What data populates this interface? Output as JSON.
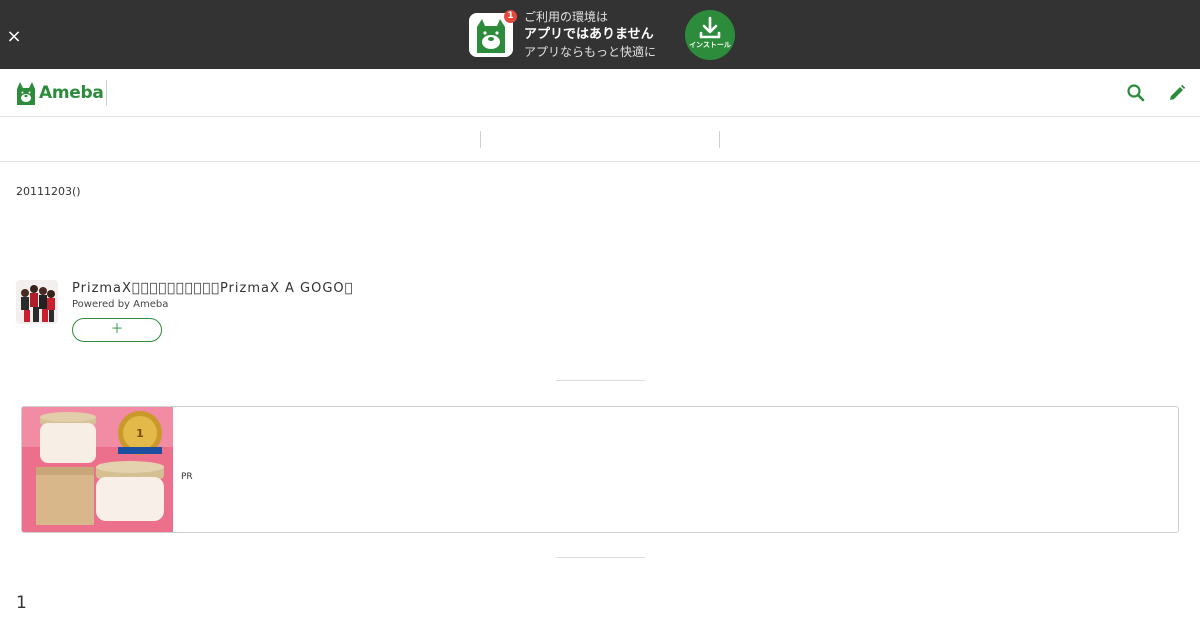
{
  "app_banner": {
    "close_label": "×",
    "badge_count": "1",
    "line1": "ご利用の環境は",
    "line2": "アプリではありません",
    "line3": "アプリならもっと快適に",
    "install_label": "インストール",
    "accent_color": "#2d8c3c"
  },
  "header": {
    "logo_text": "Ameba",
    "logo_icon": "ameba-dog-icon",
    "search_icon": "search-icon",
    "edit_icon": "pencil-icon"
  },
  "entry": {
    "date": "20111203()"
  },
  "blog": {
    "title": "PrizmaX\u0000\u0000\u0000\u0000\u0000\u0000\u0000\u0000\u0000\u0000PrizmaX A GOGO\u0000",
    "powered_by": "Powered by Ameba",
    "follow_label": "＋"
  },
  "pr_ad": {
    "label": "PR"
  },
  "footer": {
    "page_count": "1"
  }
}
